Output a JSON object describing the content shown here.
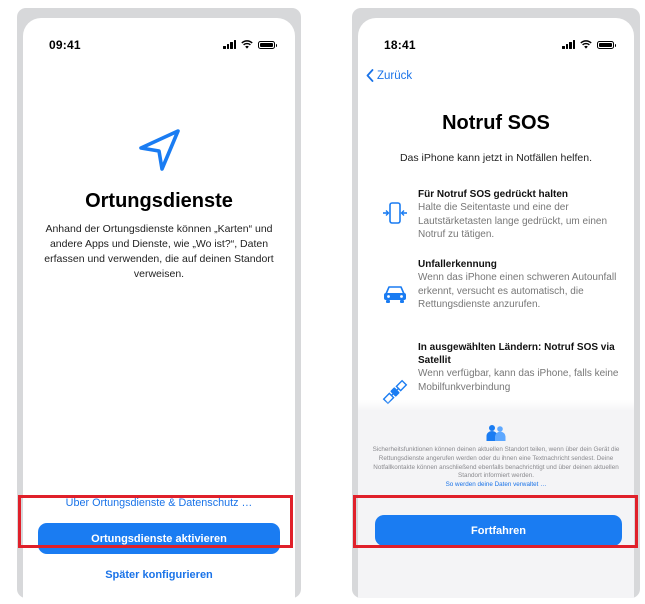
{
  "left_screen": {
    "status": {
      "time": "09:41"
    },
    "title": "Ortungsdienste",
    "description": "Anhand der Ortungsdienste können „Karten“ und andere Apps und Dienste, wie „Wo ist?“, Daten erfassen und verwenden, die auf deinen Standort verweisen.",
    "privacy_link": "Über Ortungsdienste & Datenschutz …",
    "primary_button": "Ortungsdienste aktivieren",
    "secondary_button": "Später konfigurieren",
    "icon": "location-arrow-icon"
  },
  "right_screen": {
    "status": {
      "time": "18:41"
    },
    "back_label": "Zurück",
    "title": "Notruf SOS",
    "subtitle": "Das iPhone kann jetzt in Notfällen helfen.",
    "features": [
      {
        "icon": "side-buttons-icon",
        "heading": "Für Notruf SOS gedrückt halten",
        "body": "Halte die Seitentaste und eine der Lautstärketasten lange gedrückt, um einen Notruf zu tätigen."
      },
      {
        "icon": "car-crash-icon",
        "heading": "Unfallerkennung",
        "body": "Wenn das iPhone einen schweren Autounfall erkennt, versucht es automatisch, die Rettungsdienste anzurufen."
      },
      {
        "icon": "satellite-icon",
        "heading": "In ausgewählten Ländern: Notruf SOS via Satellit",
        "body": "Wenn verfügbar, kann das iPhone, falls keine Mobilfunkverbindung"
      }
    ],
    "fine_print": "Sicherheitsfunktionen können deinen aktuellen Standort teilen, wenn über dein Gerät die Rettungsdienste angerufen werden oder du ihnen eine Textnachricht sendest. Deine Notfallkontakte können anschließend ebenfalls benachrichtigt und über deinen aktuellen Standort informiert werden.",
    "fine_link": "So werden deine Daten verwaltet …",
    "primary_button": "Fortfahren",
    "icon": "people-icon"
  },
  "colors": {
    "accent": "#1a7cf2",
    "highlight": "#e0202a",
    "frame": "#d7d8da"
  }
}
